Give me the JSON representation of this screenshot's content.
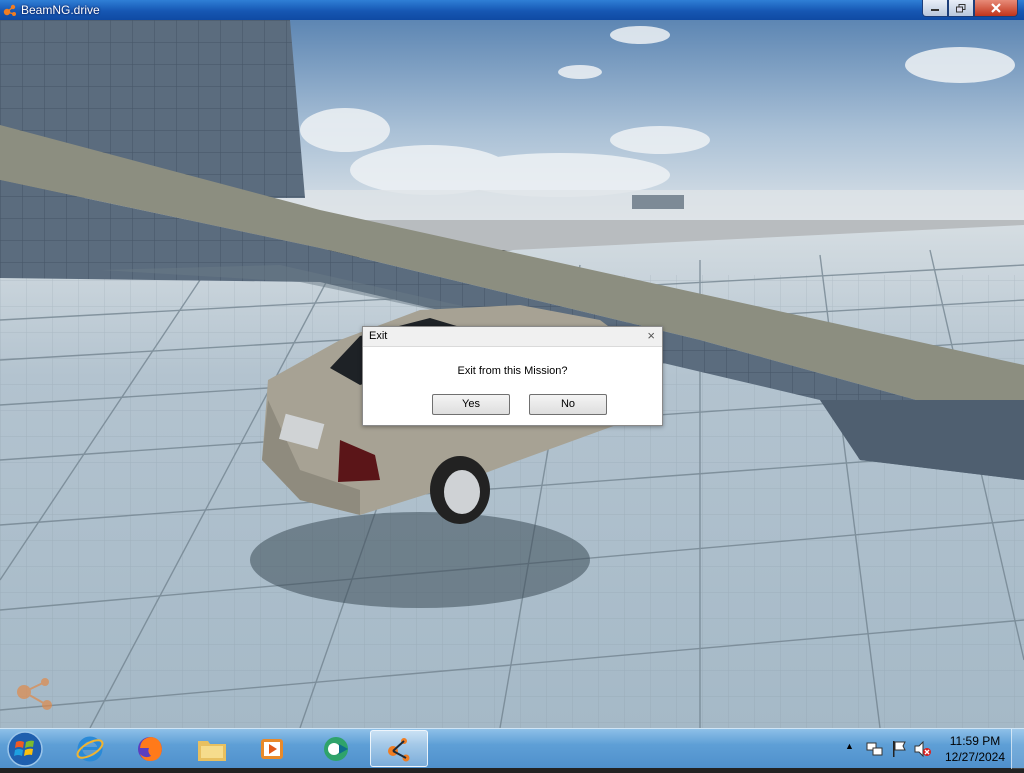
{
  "window": {
    "title": "BeamNG.drive",
    "app_icon": "beamng-logo-icon"
  },
  "dialog": {
    "title": "Exit",
    "close_glyph": "×",
    "message": "Exit from this Mission?",
    "yes_label": "Yes",
    "no_label": "No"
  },
  "taskbar": {
    "items": [
      {
        "name": "internet-explorer-icon"
      },
      {
        "name": "firefox-icon"
      },
      {
        "name": "file-explorer-icon"
      },
      {
        "name": "media-player-icon"
      },
      {
        "name": "camtasia-icon"
      },
      {
        "name": "beamng-icon",
        "active": true
      }
    ],
    "tray_arrow": "▲",
    "clock_time": "11:59 PM",
    "clock_date": "12/27/2024"
  },
  "colors": {
    "titlebar": "#1657b3",
    "taskbar": "#5e9fd6",
    "sky": "#8fb0cf",
    "grid_floor": "#a9bcc9",
    "beamng_orange": "#f07d22"
  }
}
